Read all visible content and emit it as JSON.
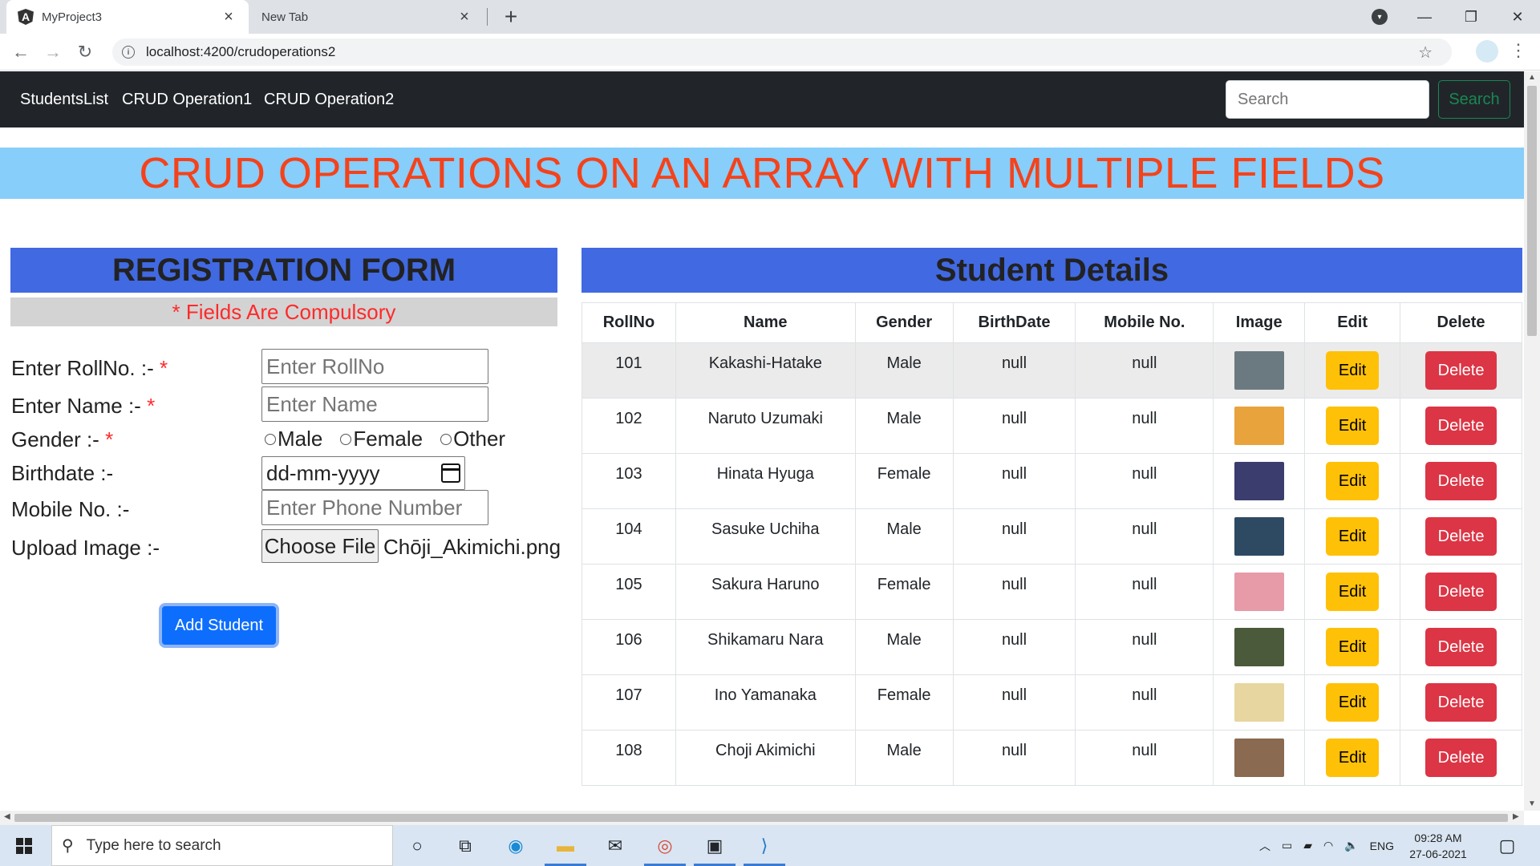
{
  "browser": {
    "active_tab_title": "MyProject3",
    "inactive_tab_title": "New Tab",
    "url": "localhost:4200/crudoperations2"
  },
  "navbar": {
    "links": [
      "StudentsList",
      "CRUD Operation1",
      "CRUD Operation2"
    ],
    "search_placeholder": "Search",
    "search_button": "Search"
  },
  "banner": {
    "title": "CRUD OPERATIONS ON AN ARRAY WITH MULTIPLE FIELDS"
  },
  "form": {
    "header": "REGISTRATION FORM",
    "required_note": "* Fields Are Compulsory",
    "rollno_label": "Enter RollNo. :-",
    "rollno_placeholder": "Enter RollNo",
    "name_label": "Enter Name :-",
    "name_placeholder": "Enter Name",
    "gender_label": "Gender :-",
    "gender_options": [
      "Male",
      "Female",
      "Other"
    ],
    "birthdate_label": "Birthdate :-",
    "birthdate_placeholder": "dd-mm-yyyy",
    "mobile_label": "Mobile No. :-",
    "mobile_placeholder": "Enter Phone Number",
    "upload_label": "Upload Image :-",
    "choose_file_label": "Choose File",
    "chosen_file": "Chōji_Akimichi.png",
    "required_mark": "*",
    "submit_label": "Add Student"
  },
  "details": {
    "header": "Student Details",
    "columns": [
      "RollNo",
      "Name",
      "Gender",
      "BirthDate",
      "Mobile No.",
      "Image",
      "Edit",
      "Delete"
    ],
    "edit_label": "Edit",
    "delete_label": "Delete",
    "rows": [
      {
        "rollno": "101",
        "name": "Kakashi-Hatake",
        "gender": "Male",
        "birthdate": "null",
        "mobile": "null",
        "image_color": "#6b7a80"
      },
      {
        "rollno": "102",
        "name": "Naruto Uzumaki",
        "gender": "Male",
        "birthdate": "null",
        "mobile": "null",
        "image_color": "#e8a33c"
      },
      {
        "rollno": "103",
        "name": "Hinata Hyuga",
        "gender": "Female",
        "birthdate": "null",
        "mobile": "null",
        "image_color": "#3a3d6e"
      },
      {
        "rollno": "104",
        "name": "Sasuke Uchiha",
        "gender": "Male",
        "birthdate": "null",
        "mobile": "null",
        "image_color": "#2e4a63"
      },
      {
        "rollno": "105",
        "name": "Sakura Haruno",
        "gender": "Female",
        "birthdate": "null",
        "mobile": "null",
        "image_color": "#e79aa8"
      },
      {
        "rollno": "106",
        "name": "Shikamaru Nara",
        "gender": "Male",
        "birthdate": "null",
        "mobile": "null",
        "image_color": "#4a5a3a"
      },
      {
        "rollno": "107",
        "name": "Ino Yamanaka",
        "gender": "Female",
        "birthdate": "null",
        "mobile": "null",
        "image_color": "#e8d6a0"
      },
      {
        "rollno": "108",
        "name": "Choji Akimichi",
        "gender": "Male",
        "birthdate": "null",
        "mobile": "null",
        "image_color": "#8a6a50"
      }
    ]
  },
  "taskbar": {
    "search_placeholder": "Type here to search",
    "language": "ENG",
    "time": "09:28 AM",
    "date": "27-06-2021"
  },
  "colors": {
    "navbar_bg": "#212529",
    "banner_bg": "#87cefa",
    "banner_text": "#f5421a",
    "section_header_bg": "#4169e1",
    "edit_button": "#ffc107",
    "delete_button": "#dc3545",
    "add_button": "#0d6efd"
  }
}
